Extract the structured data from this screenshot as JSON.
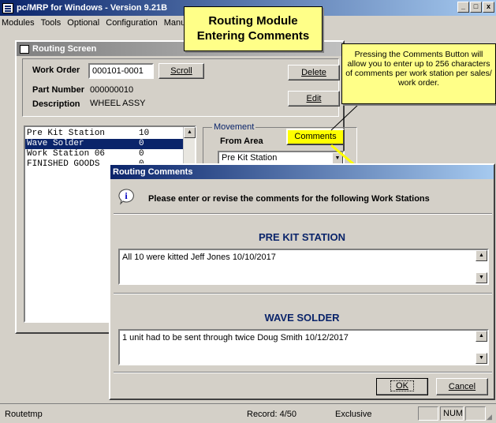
{
  "app": {
    "title": "pc/MRP for Windows - Version 9.21B",
    "window_buttons": {
      "minimize": "_",
      "maximize": "□",
      "close": "x"
    }
  },
  "menu": [
    "Modules",
    "Tools",
    "Optional",
    "Configuration",
    "Manua"
  ],
  "callout_title": {
    "line1": "Routing Module",
    "line2": "Entering Comments"
  },
  "callout_info": "Pressing the Comments Button will allow you to enter up to 256 characters of comments per work station per sales/ work order.",
  "routing": {
    "title": "Routing Screen",
    "work_order_label": "Work Order",
    "work_order_value": "000101-0001",
    "scroll_label": "Scroll",
    "part_number_label": "Part Number",
    "part_number_value": "000000010",
    "description_label": "Description",
    "description_value": "WHEEL ASSY",
    "delete_label": "Delete",
    "edit_label": "Edit",
    "stations": [
      {
        "name": "Pre Kit Station",
        "qty": "10"
      },
      {
        "name": "Wave Solder",
        "qty": "0"
      },
      {
        "name": "Work Station 06",
        "qty": "0"
      },
      {
        "name": "FINISHED GOODS",
        "qty": "0"
      }
    ],
    "movement_label": "Movement",
    "from_area_label": "From Area",
    "from_area_value": "Pre Kit Station",
    "comments_label": "Comments"
  },
  "dialog": {
    "title": "Routing Comments",
    "prompt": "Please enter or revise the comments for the following Work Stations",
    "section1_title": "PRE KIT STATION",
    "section1_comment": "All 10 were kitted  Jeff Jones 10/10/2017",
    "section2_title": "WAVE SOLDER",
    "section2_comment": "1 unit had to be sent through twice Doug Smith 10/12/2017",
    "ok_label": "OK",
    "cancel_label": "Cancel"
  },
  "status": {
    "table": "Routetmp",
    "record": "Record: 4/50",
    "mode": "Exclusive",
    "num": "NUM"
  },
  "colors": {
    "titlebar": "#0a246a",
    "callout": "#ffff88",
    "highlight": "#ffff00"
  }
}
